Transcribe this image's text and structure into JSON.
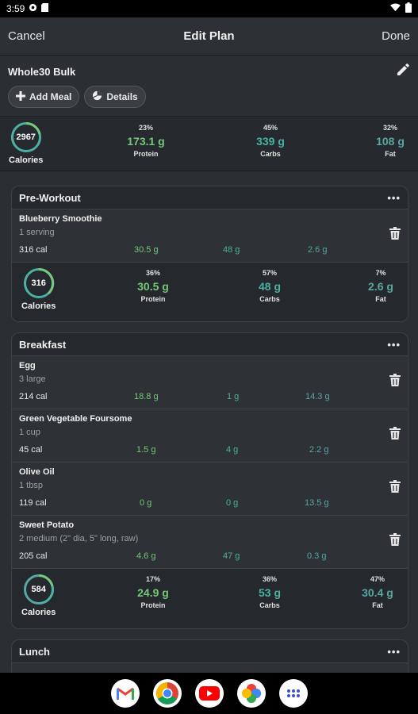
{
  "status": {
    "time": "3:59",
    "icons": [
      "wifi-icon",
      "battery-icon"
    ]
  },
  "nav": {
    "cancel": "Cancel",
    "title": "Edit Plan",
    "done": "Done"
  },
  "plan": {
    "name": "Whole30 Bulk",
    "add_meal": "Add Meal",
    "details": "Details",
    "totals": {
      "calories": "2967",
      "calories_label": "Calories",
      "protein_pct": "23%",
      "protein": "173.1 g",
      "protein_label": "Protein",
      "carbs_pct": "45%",
      "carbs": "339 g",
      "carbs_label": "Carbs",
      "fat_pct": "32%",
      "fat": "108 g",
      "fat_label": "Fat"
    }
  },
  "meals": [
    {
      "title": "Pre-Workout",
      "foods": [
        {
          "name": "Blueberry Smoothie",
          "serving": "1 serving",
          "cal": "316 cal",
          "protein": "30.5 g",
          "carbs": "48 g",
          "fat": "2.6 g"
        }
      ],
      "summary": {
        "calories": "316",
        "calories_label": "Calories",
        "protein_pct": "36%",
        "protein": "30.5 g",
        "protein_label": "Protein",
        "carbs_pct": "57%",
        "carbs": "48 g",
        "carbs_label": "Carbs",
        "fat_pct": "7%",
        "fat": "2.6 g",
        "fat_label": "Fat"
      }
    },
    {
      "title": "Breakfast",
      "foods": [
        {
          "name": "Egg",
          "serving": "3 large",
          "cal": "214 cal",
          "protein": "18.8 g",
          "carbs": "1 g",
          "fat": "14.3 g"
        },
        {
          "name": "Green Vegetable Foursome",
          "serving": "1 cup",
          "cal": "45 cal",
          "protein": "1.5 g",
          "carbs": "4 g",
          "fat": "2.2 g"
        },
        {
          "name": "Olive Oil",
          "serving": "1 tbsp",
          "cal": "119 cal",
          "protein": "0 g",
          "carbs": "0 g",
          "fat": "13.5 g"
        },
        {
          "name": "Sweet Potato",
          "serving": "2 medium (2\" dia, 5\" long, raw)",
          "cal": "205 cal",
          "protein": "4.6 g",
          "carbs": "47 g",
          "fat": "0.3 g"
        }
      ],
      "summary": {
        "calories": "584",
        "calories_label": "Calories",
        "protein_pct": "17%",
        "protein": "24.9 g",
        "protein_label": "Protein",
        "carbs_pct": "36%",
        "carbs": "53 g",
        "carbs_label": "Carbs",
        "fat_pct": "47%",
        "fat": "30.4 g",
        "fat_label": "Fat"
      }
    },
    {
      "title": "Lunch"
    }
  ],
  "colors": {
    "protein": "#76c77b",
    "carbs": "#4ab2a2",
    "fat": "#58a7a2",
    "background": "#2b2e32"
  },
  "dock": [
    "gmail-icon",
    "chrome-icon",
    "youtube-icon",
    "photos-icon",
    "app-drawer-icon"
  ]
}
